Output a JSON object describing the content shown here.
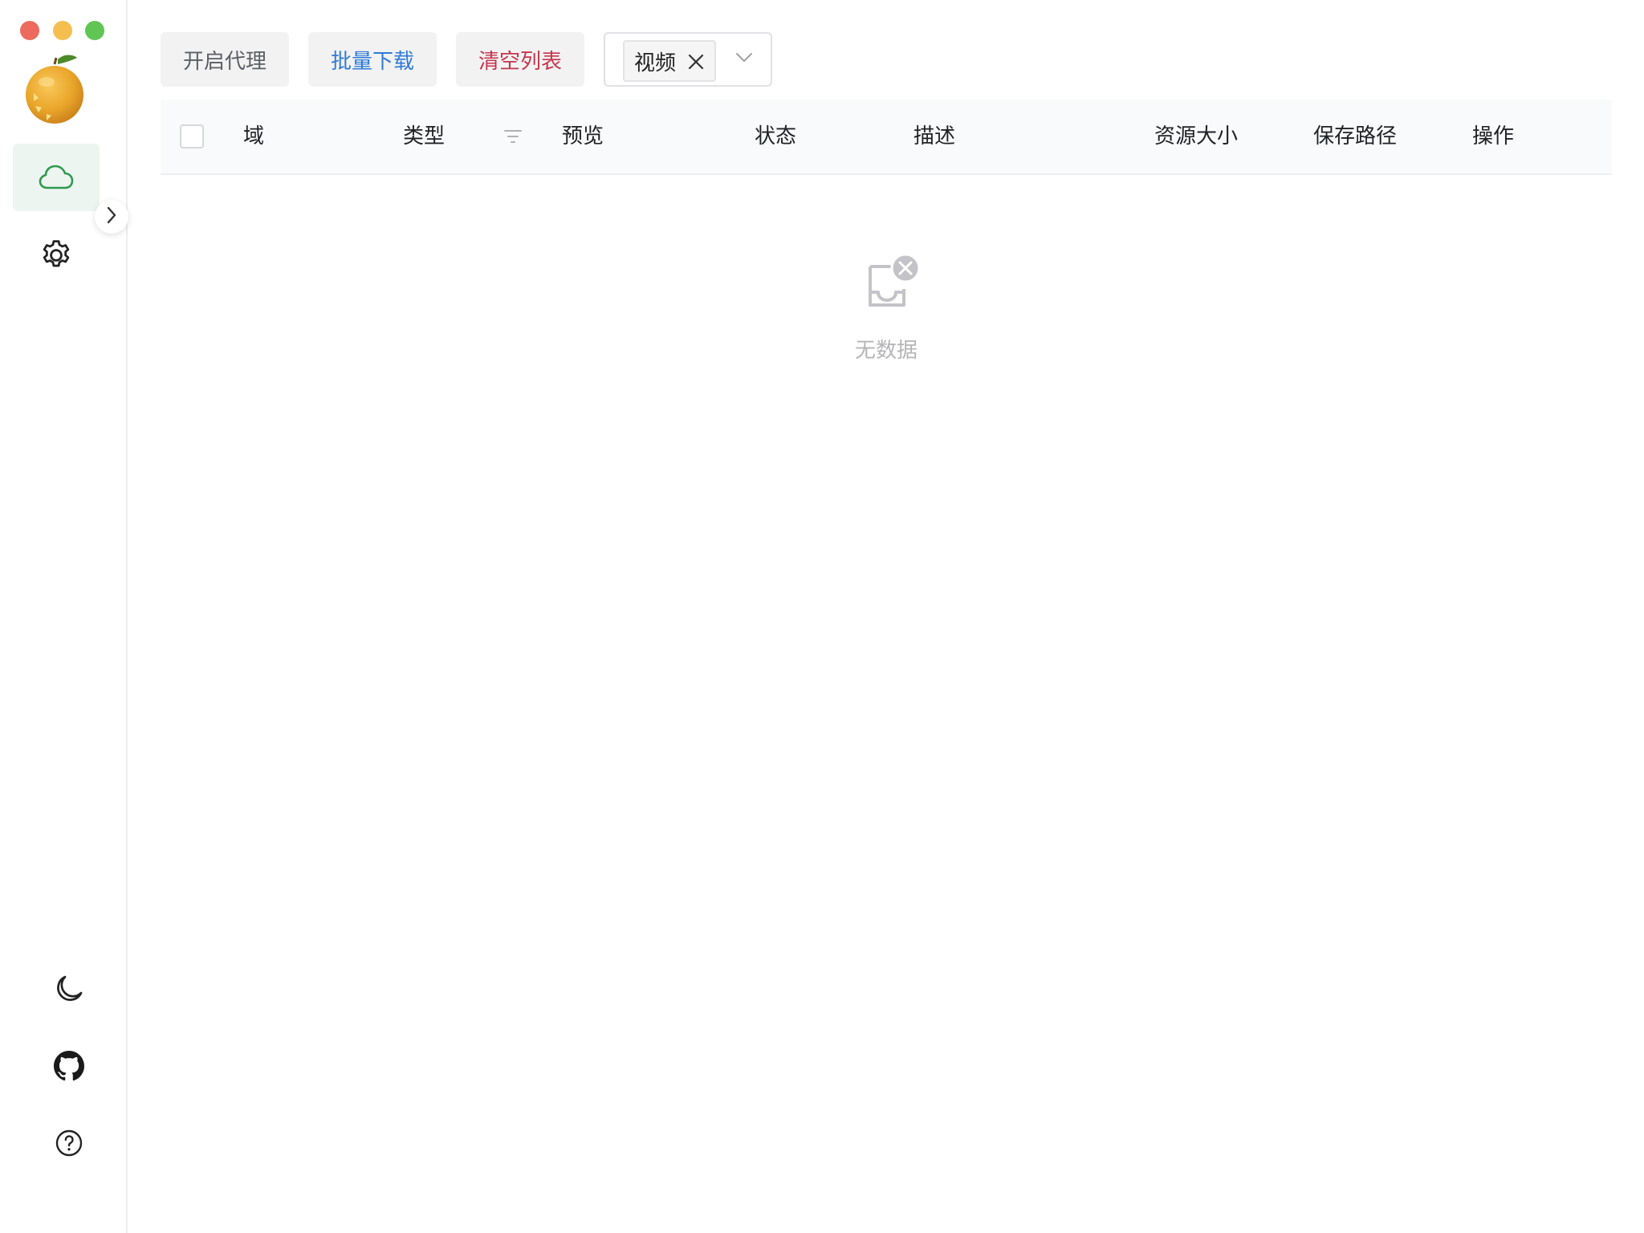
{
  "window": {
    "controls": [
      "close",
      "minimize",
      "maximize"
    ]
  },
  "sidebar": {
    "logo_icon": "orange-logo-icon",
    "nav": [
      {
        "id": "resources",
        "icon": "cloud-icon",
        "active": true
      },
      {
        "id": "settings",
        "icon": "gear-icon",
        "active": false
      }
    ],
    "collapse_icon": "chevron-right-icon",
    "bottom": [
      {
        "id": "theme",
        "icon": "moon-icon"
      },
      {
        "id": "github",
        "icon": "github-icon"
      },
      {
        "id": "help",
        "icon": "question-circle-icon"
      }
    ]
  },
  "toolbar": {
    "proxy_label": "开启代理",
    "batch_download_label": "批量下载",
    "clear_list_label": "清空列表",
    "type_select": {
      "selected_tags": [
        "视频"
      ]
    }
  },
  "table": {
    "columns": {
      "domain": "域",
      "type": "类型",
      "preview": "预览",
      "status": "状态",
      "description": "描述",
      "size": "资源大小",
      "save_path": "保存路径",
      "actions": "操作"
    },
    "rows": [],
    "empty_text": "无数据"
  },
  "colors": {
    "accent_green": "#2f9a4e",
    "active_nav_bg": "#edf5f0",
    "batch_blue": "#2f7bd7",
    "clear_red": "#c7354c",
    "header_bg": "#f9fafb"
  }
}
